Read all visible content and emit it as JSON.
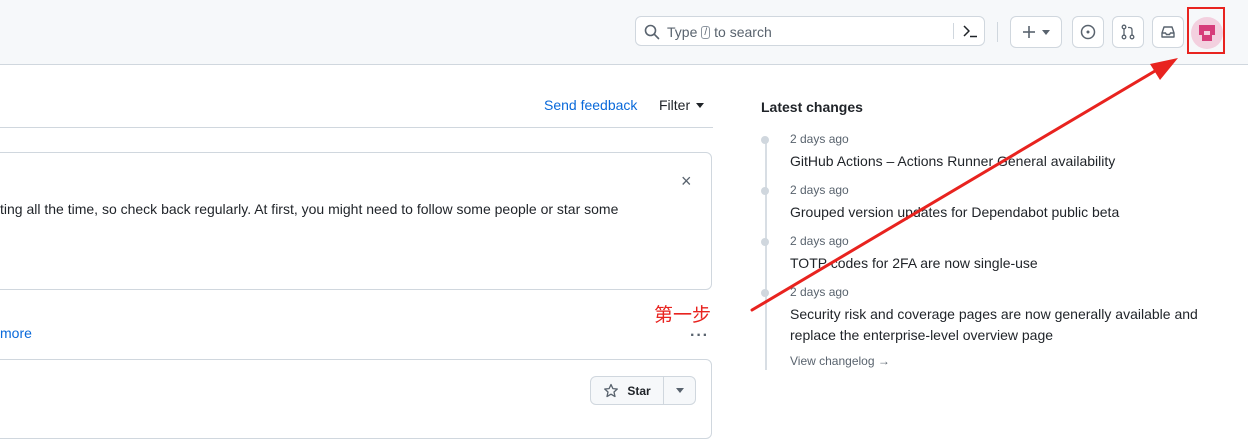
{
  "header": {
    "search_prefix": "Type",
    "search_key": "/",
    "search_suffix": "to search"
  },
  "feed": {
    "send_feedback": "Send feedback",
    "filter": "Filter",
    "notice_text": "ting all the time, so check back regularly. At first, you might need to follow some people or star some",
    "close_glyph": "×",
    "more_link": "more",
    "kebab": "···",
    "star_label": "Star"
  },
  "changelog": {
    "title": "Latest changes",
    "items": [
      {
        "time": "2 days ago",
        "title": "GitHub Actions – Actions Runner General availability"
      },
      {
        "time": "2 days ago",
        "title": "Grouped version updates for Dependabot public beta"
      },
      {
        "time": "2 days ago",
        "title": "TOTP codes for 2FA are now single-use"
      },
      {
        "time": "2 days ago",
        "title": "Security risk and coverage pages are now generally available and replace the enterprise-level overview page"
      }
    ],
    "view_link": "View changelog →"
  },
  "annotation": {
    "label": "第一步",
    "color": "#e8231f"
  },
  "colors": {
    "link": "#0969da",
    "header_bg": "#f6f8fa",
    "border": "#d0d7de",
    "avatar_bg": "#f3d0df",
    "avatar_fg": "#d63c7a"
  },
  "icons": [
    "search-icon",
    "command-palette-icon",
    "plus-icon",
    "chevron-down-icon",
    "issues-icon",
    "pull-request-icon",
    "inbox-icon",
    "avatar",
    "close-icon",
    "star-icon"
  ]
}
